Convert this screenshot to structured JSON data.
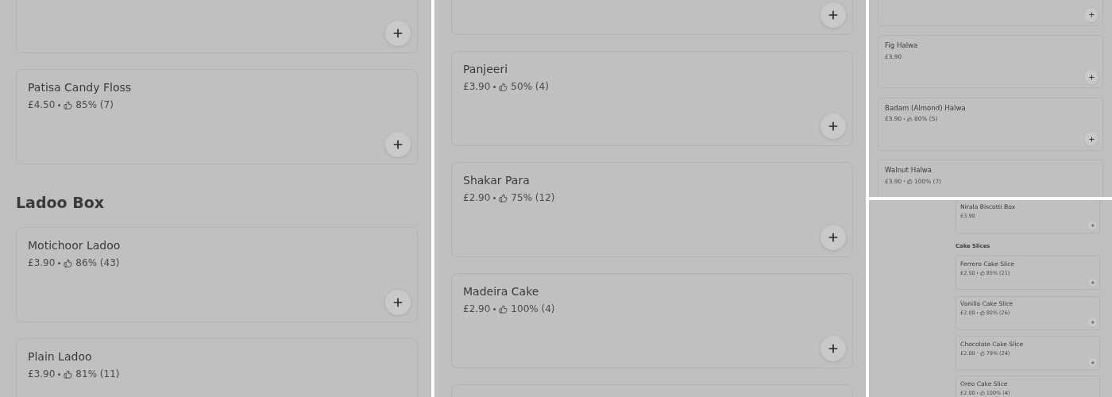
{
  "panels": [
    {
      "items": [
        {
          "kind": "card",
          "add_button": true
        },
        {
          "kind": "card",
          "name": "Patisa Candy Floss",
          "price": "£4.50",
          "rating": "85% (7)",
          "add_button": true
        },
        {
          "kind": "heading",
          "text": "Ladoo Box"
        },
        {
          "kind": "card",
          "name": "Motichoor Ladoo",
          "price": "£3.90",
          "rating": "86% (43)",
          "add_button": true
        },
        {
          "kind": "card",
          "name": "Plain Ladoo",
          "price": "£3.90",
          "rating": "81% (11)"
        }
      ]
    },
    {
      "items": [
        {
          "kind": "card",
          "add_button": true
        },
        {
          "kind": "card",
          "name": "Panjeeri",
          "price": "£3.90",
          "rating": "50% (4)",
          "add_button": true
        },
        {
          "kind": "card",
          "name": "Shakar Para",
          "price": "£2.90",
          "rating": "75% (12)",
          "add_button": true
        },
        {
          "kind": "card",
          "name": "Madeira Cake",
          "price": "£2.90",
          "rating": "100% (4)",
          "add_button": true
        },
        {
          "kind": "card"
        }
      ]
    },
    {
      "items": [
        {
          "kind": "card",
          "add_button": true
        },
        {
          "kind": "card",
          "name": "Fig Halwa",
          "price": "£3.90",
          "add_button": true
        },
        {
          "kind": "card",
          "name": "Badam (Almond) Halwa",
          "price": "£3.90",
          "rating": "80% (5)",
          "add_button": true
        },
        {
          "kind": "card",
          "name": "Walnut Halwa",
          "price": "£3.90",
          "rating": "100% (7)"
        }
      ]
    },
    {
      "items": [
        {
          "kind": "card",
          "name": "Nirala Biscotti Box",
          "price": "£3.90",
          "add_button": true
        },
        {
          "kind": "heading",
          "text": "Cake Slices"
        },
        {
          "kind": "card",
          "name": "Ferrero Cake Slice",
          "price": "£2.50",
          "rating": "85% (21)",
          "add_button": true
        },
        {
          "kind": "card",
          "name": "Vanilla Cake Slice",
          "price": "£2.00",
          "rating": "80% (26)",
          "add_button": true
        },
        {
          "kind": "card",
          "name": "Chocolate Cake Slice",
          "price": "£2.00",
          "rating": "79% (24)",
          "add_button": true
        },
        {
          "kind": "card",
          "name": "Oreo Cake Slice",
          "price": "£2.00",
          "rating": "100% (4)"
        }
      ]
    }
  ]
}
